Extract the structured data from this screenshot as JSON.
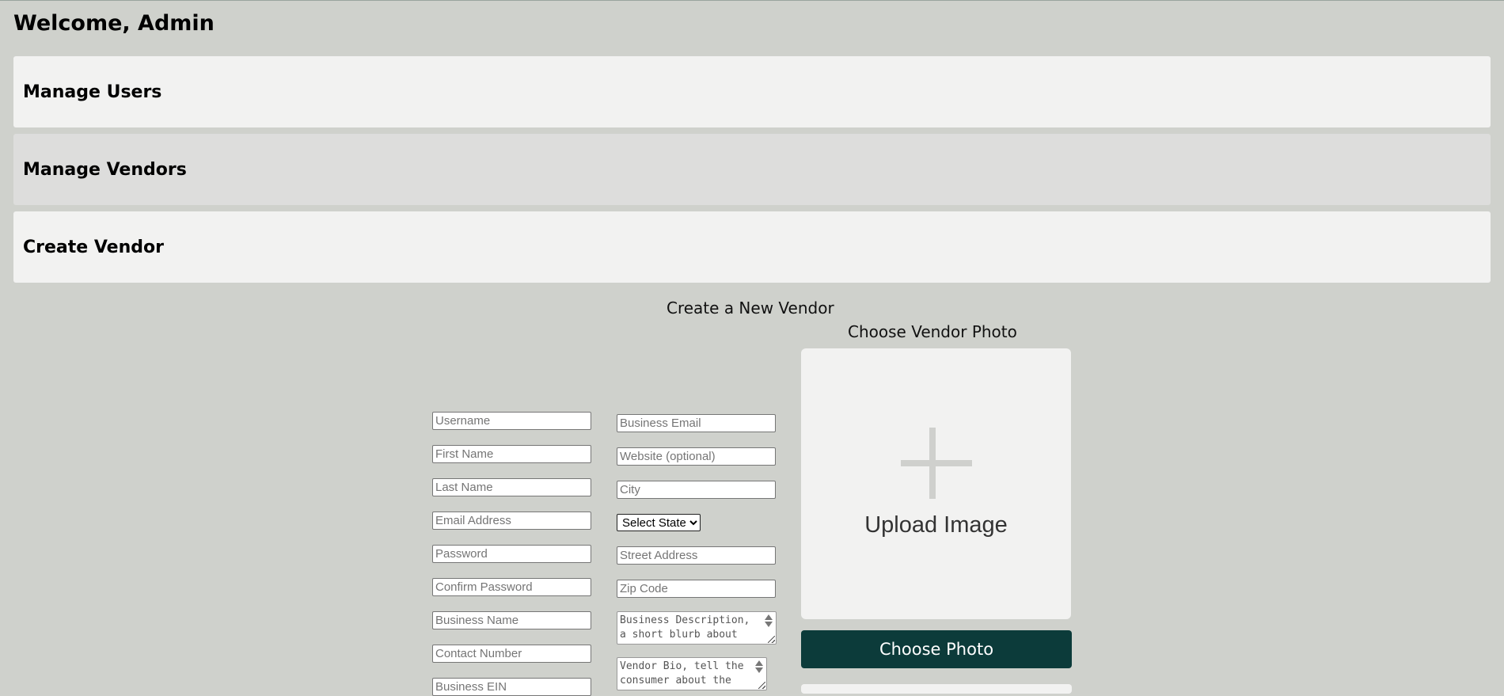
{
  "header": {
    "welcome": "Welcome, Admin"
  },
  "panels": [
    {
      "label": "Manage Users"
    },
    {
      "label": "Manage Vendors"
    },
    {
      "label": "Create Vendor"
    }
  ],
  "form": {
    "title": "Create a New Vendor",
    "left_fields": [
      {
        "placeholder": "Username",
        "value": ""
      },
      {
        "placeholder": "First Name",
        "value": ""
      },
      {
        "placeholder": "Last Name",
        "value": ""
      },
      {
        "placeholder": "Email Address",
        "value": ""
      },
      {
        "placeholder": "Password",
        "value": ""
      },
      {
        "placeholder": "Confirm Password",
        "value": ""
      },
      {
        "placeholder": "Business Name",
        "value": ""
      },
      {
        "placeholder": "Contact Number",
        "value": ""
      },
      {
        "placeholder": "Business EIN",
        "value": ""
      }
    ],
    "right_fields": {
      "business_email": "Business Email",
      "website": "Website (optional)",
      "city": "City",
      "state_selected": "Select State",
      "street": "Street Address",
      "zip": "Zip Code",
      "business_description": "Business Description, a short blurb about",
      "vendor_bio": "Vendor Bio, tell the consumer about the"
    }
  },
  "photo": {
    "title": "Choose Vendor Photo",
    "upload_label": "Upload Image",
    "button_label": "Choose Photo"
  },
  "colors": {
    "background": "#cfd1cc",
    "panel_light": "#f2f2f1",
    "panel_mid": "#dddddc",
    "button": "#0c3b3a"
  }
}
